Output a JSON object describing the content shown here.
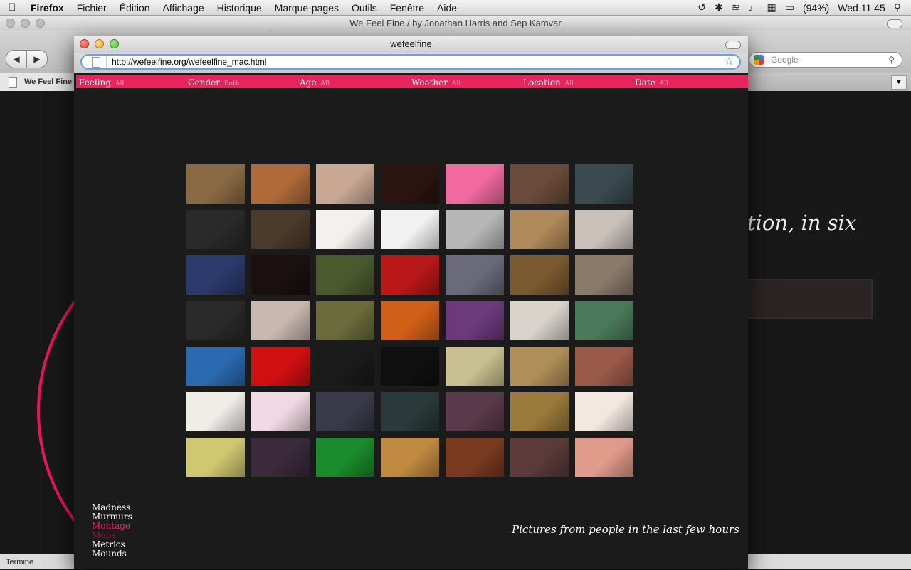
{
  "menubar": {
    "items": [
      "Firefox",
      "Fichier",
      "Édition",
      "Affichage",
      "Historique",
      "Marque-pages",
      "Outils",
      "Fenêtre",
      "Aide"
    ],
    "battery": "(94%)",
    "clock": "Wed 11 45"
  },
  "bg_window": {
    "title": "We Feel Fine / by Jonathan Harris and Sep Kamvar",
    "tab_label": "We Feel Fine",
    "search_placeholder": "Google",
    "heading_fragment": "tion, in six",
    "status": "Terminé"
  },
  "window": {
    "title": "wefeelfine",
    "url": "http://wefeelfine.org/wefeelfine_mac.html"
  },
  "filters": [
    {
      "label": "Feeling",
      "value": "All"
    },
    {
      "label": "Gender",
      "value": "Both"
    },
    {
      "label": "Age",
      "value": "All"
    },
    {
      "label": "Weather",
      "value": "All"
    },
    {
      "label": "Location",
      "value": "All"
    },
    {
      "label": "Date",
      "value": "All"
    }
  ],
  "montage": {
    "rows": 7,
    "cols": 7,
    "thumb_colors": [
      "#8a6a44",
      "#b06a3a",
      "#c9a894",
      "#2a1410",
      "#f06aa0",
      "#6a4a3a",
      "#3a4a4e",
      "#2a2a2a",
      "#4a3a2a",
      "#f4f0ee",
      "#f2f2f2",
      "#b7b7b7",
      "#b08a5a",
      "#c9c0ba",
      "#2a3a6a",
      "#1a1010",
      "#4a5a2e",
      "#b81818",
      "#6a6a7a",
      "#7a5a30",
      "#8a7a6a",
      "#2a2a2a",
      "#c8b8b0",
      "#6a6a3a",
      "#d06018",
      "#6a3a7a",
      "#d8d4cc",
      "#4a7a5a",
      "#2a6ab0",
      "#d01010",
      "#1a1a1a",
      "#101010",
      "#c8c090",
      "#b0905a",
      "#9a5a4a",
      "#f0ece8",
      "#f2d8e2",
      "#3a3a4a",
      "#2a3a3a",
      "#5a3a4a",
      "#9a7a3a",
      "#f2e8e0",
      "#d0c870",
      "#3a2a3a",
      "#1a8a2a",
      "#c08a40",
      "#7a3a20",
      "#5a3a3a",
      "#e09a8a"
    ]
  },
  "side_menu": [
    {
      "label": "Madness",
      "state": "normal"
    },
    {
      "label": "Murmurs",
      "state": "normal"
    },
    {
      "label": "Montage",
      "state": "active"
    },
    {
      "label": "Mobs",
      "state": "dim"
    },
    {
      "label": "Metrics",
      "state": "normal"
    },
    {
      "label": "Mounds",
      "state": "normal"
    }
  ],
  "caption": "Pictures from people in the last few hours"
}
